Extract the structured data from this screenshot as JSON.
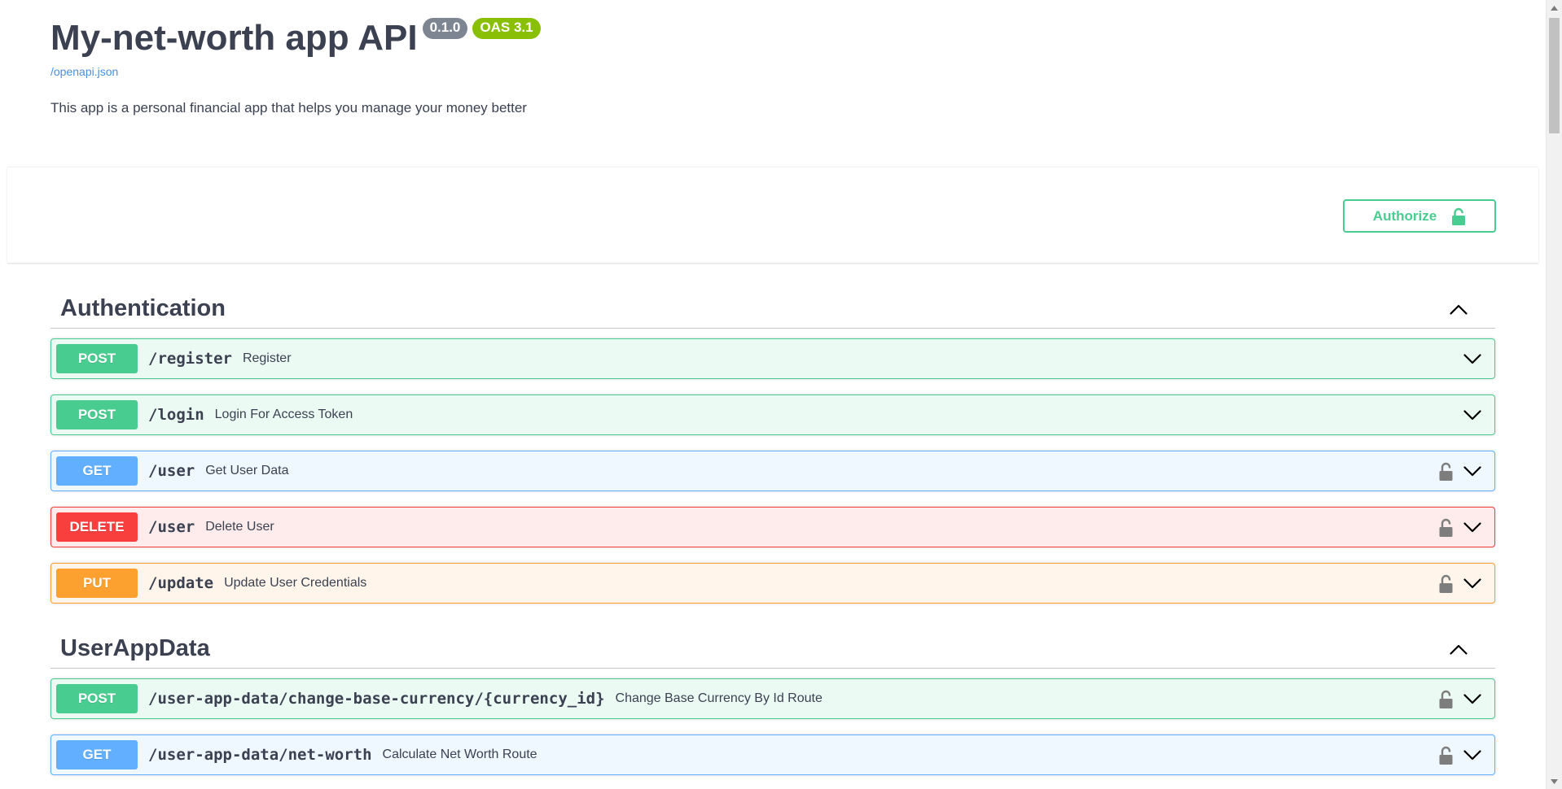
{
  "info": {
    "title": "My-net-worth app API",
    "version": "0.1.0",
    "oas": "OAS 3.1",
    "spec_link": "/openapi.json",
    "description": "This app is a personal financial app that helps you manage your money better"
  },
  "authorize": {
    "label": "Authorize",
    "icon": "unlock-icon"
  },
  "tags": [
    {
      "name": "Authentication",
      "expanded": true,
      "operations": [
        {
          "method": "POST",
          "path": "/register",
          "summary": "Register",
          "locked": false
        },
        {
          "method": "POST",
          "path": "/login",
          "summary": "Login For Access Token",
          "locked": false
        },
        {
          "method": "GET",
          "path": "/user",
          "summary": "Get User Data",
          "locked": true
        },
        {
          "method": "DELETE",
          "path": "/user",
          "summary": "Delete User",
          "locked": true
        },
        {
          "method": "PUT",
          "path": "/update",
          "summary": "Update User Credentials",
          "locked": true
        }
      ]
    },
    {
      "name": "UserAppData",
      "expanded": true,
      "operations": [
        {
          "method": "POST",
          "path": "/user-app-data/change-base-currency/{currency_id}",
          "summary": "Change Base Currency By Id Route",
          "locked": true
        },
        {
          "method": "GET",
          "path": "/user-app-data/net-worth",
          "summary": "Calculate Net Worth Route",
          "locked": true
        }
      ]
    }
  ],
  "colors": {
    "post": "#49cc90",
    "get": "#61affe",
    "delete": "#f93e3e",
    "put": "#fca130",
    "link": "#4990e2",
    "version_badge": "#7d8492",
    "oas_badge": "#89bf04"
  }
}
